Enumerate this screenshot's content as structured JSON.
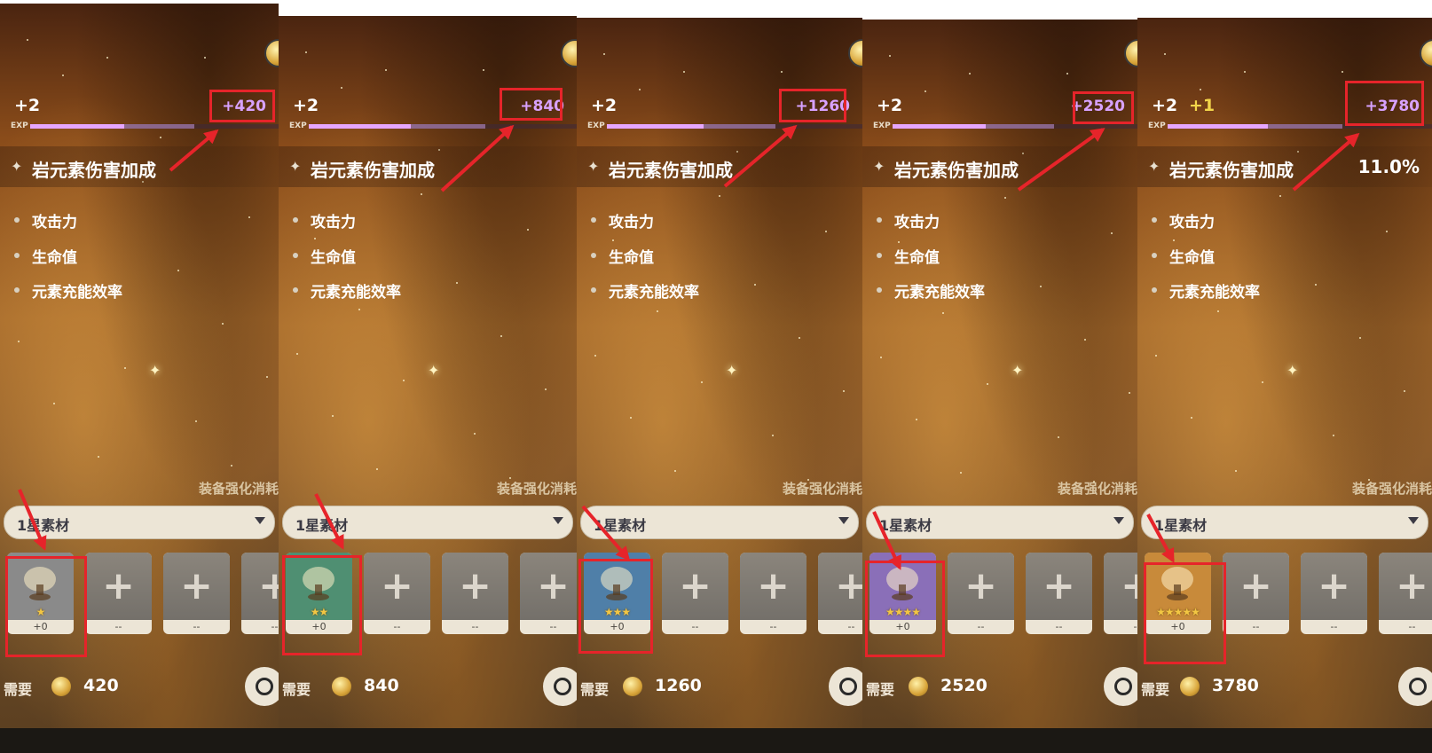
{
  "panels": [
    {
      "level": "+2",
      "level_next": "",
      "exp_gain": "+420",
      "exp_label": "EXP",
      "main_stat_name": "岩元素伤害加成",
      "main_stat_value": "",
      "substats": [
        "攻击力",
        "生命值",
        "元素充能效率"
      ],
      "cost_title": "装备强化消耗",
      "filter_label": "1星素材",
      "material": {
        "name": "chalice-icon",
        "stars": "★",
        "level": "+0",
        "rarity": 1
      },
      "empty_slot_label": "--",
      "need_label": "需要",
      "need_amount": "420"
    },
    {
      "level": "+2",
      "level_next": "",
      "exp_gain": "+840",
      "exp_label": "EXP",
      "main_stat_name": "岩元素伤害加成",
      "main_stat_value": "",
      "substats": [
        "攻击力",
        "生命值",
        "元素充能效率"
      ],
      "cost_title": "装备强化消耗",
      "filter_label": "1星素材",
      "material": {
        "name": "chalice-icon",
        "stars": "★★",
        "level": "+0",
        "rarity": 2
      },
      "empty_slot_label": "--",
      "need_label": "需要",
      "need_amount": "840"
    },
    {
      "level": "+2",
      "level_next": "",
      "exp_gain": "+1260",
      "exp_label": "EXP",
      "main_stat_name": "岩元素伤害加成",
      "main_stat_value": "",
      "substats": [
        "攻击力",
        "生命值",
        "元素充能效率"
      ],
      "cost_title": "装备强化消耗",
      "filter_label": "1星素材",
      "material": {
        "name": "feather-icon",
        "stars": "★★★",
        "level": "+0",
        "rarity": 3
      },
      "empty_slot_label": "--",
      "need_label": "需要",
      "need_amount": "1260"
    },
    {
      "level": "+2",
      "level_next": "",
      "exp_gain": "+2520",
      "exp_label": "EXP",
      "main_stat_name": "岩元素伤害加成",
      "main_stat_value": "",
      "substats": [
        "攻击力",
        "生命值",
        "元素充能效率"
      ],
      "cost_title": "装备强化消耗",
      "filter_label": "1星素材",
      "material": {
        "name": "teacup-icon",
        "stars": "★★★★",
        "level": "+0",
        "rarity": 4
      },
      "empty_slot_label": "--",
      "need_label": "需要",
      "need_amount": "2520"
    },
    {
      "level": "+2",
      "level_next": "+1",
      "exp_gain": "+3780",
      "exp_label": "EXP",
      "main_stat_name": "岩元素伤害加成",
      "main_stat_value": "11.0%",
      "substats": [
        "攻击力",
        "生命值",
        "元素充能效率"
      ],
      "cost_title": "装备强化消耗",
      "filter_label": "1星素材",
      "material": {
        "name": "crown-icon",
        "stars": "★★★★★",
        "level": "+0",
        "rarity": 5
      },
      "empty_slot_label": "--",
      "need_label": "需要",
      "need_amount": "3780"
    }
  ],
  "colors": {
    "highlight": "#e6242a",
    "exp_bar": "#e6a6ff",
    "exp_gain_text": "#d8a2ff",
    "level_next": "#f2d54a",
    "rarity_1": "#8a8a8a",
    "rarity_2": "#4f8f72",
    "rarity_3": "#4f7fa8",
    "rarity_4": "#8a6fb8",
    "rarity_5": "#c88a3a"
  }
}
